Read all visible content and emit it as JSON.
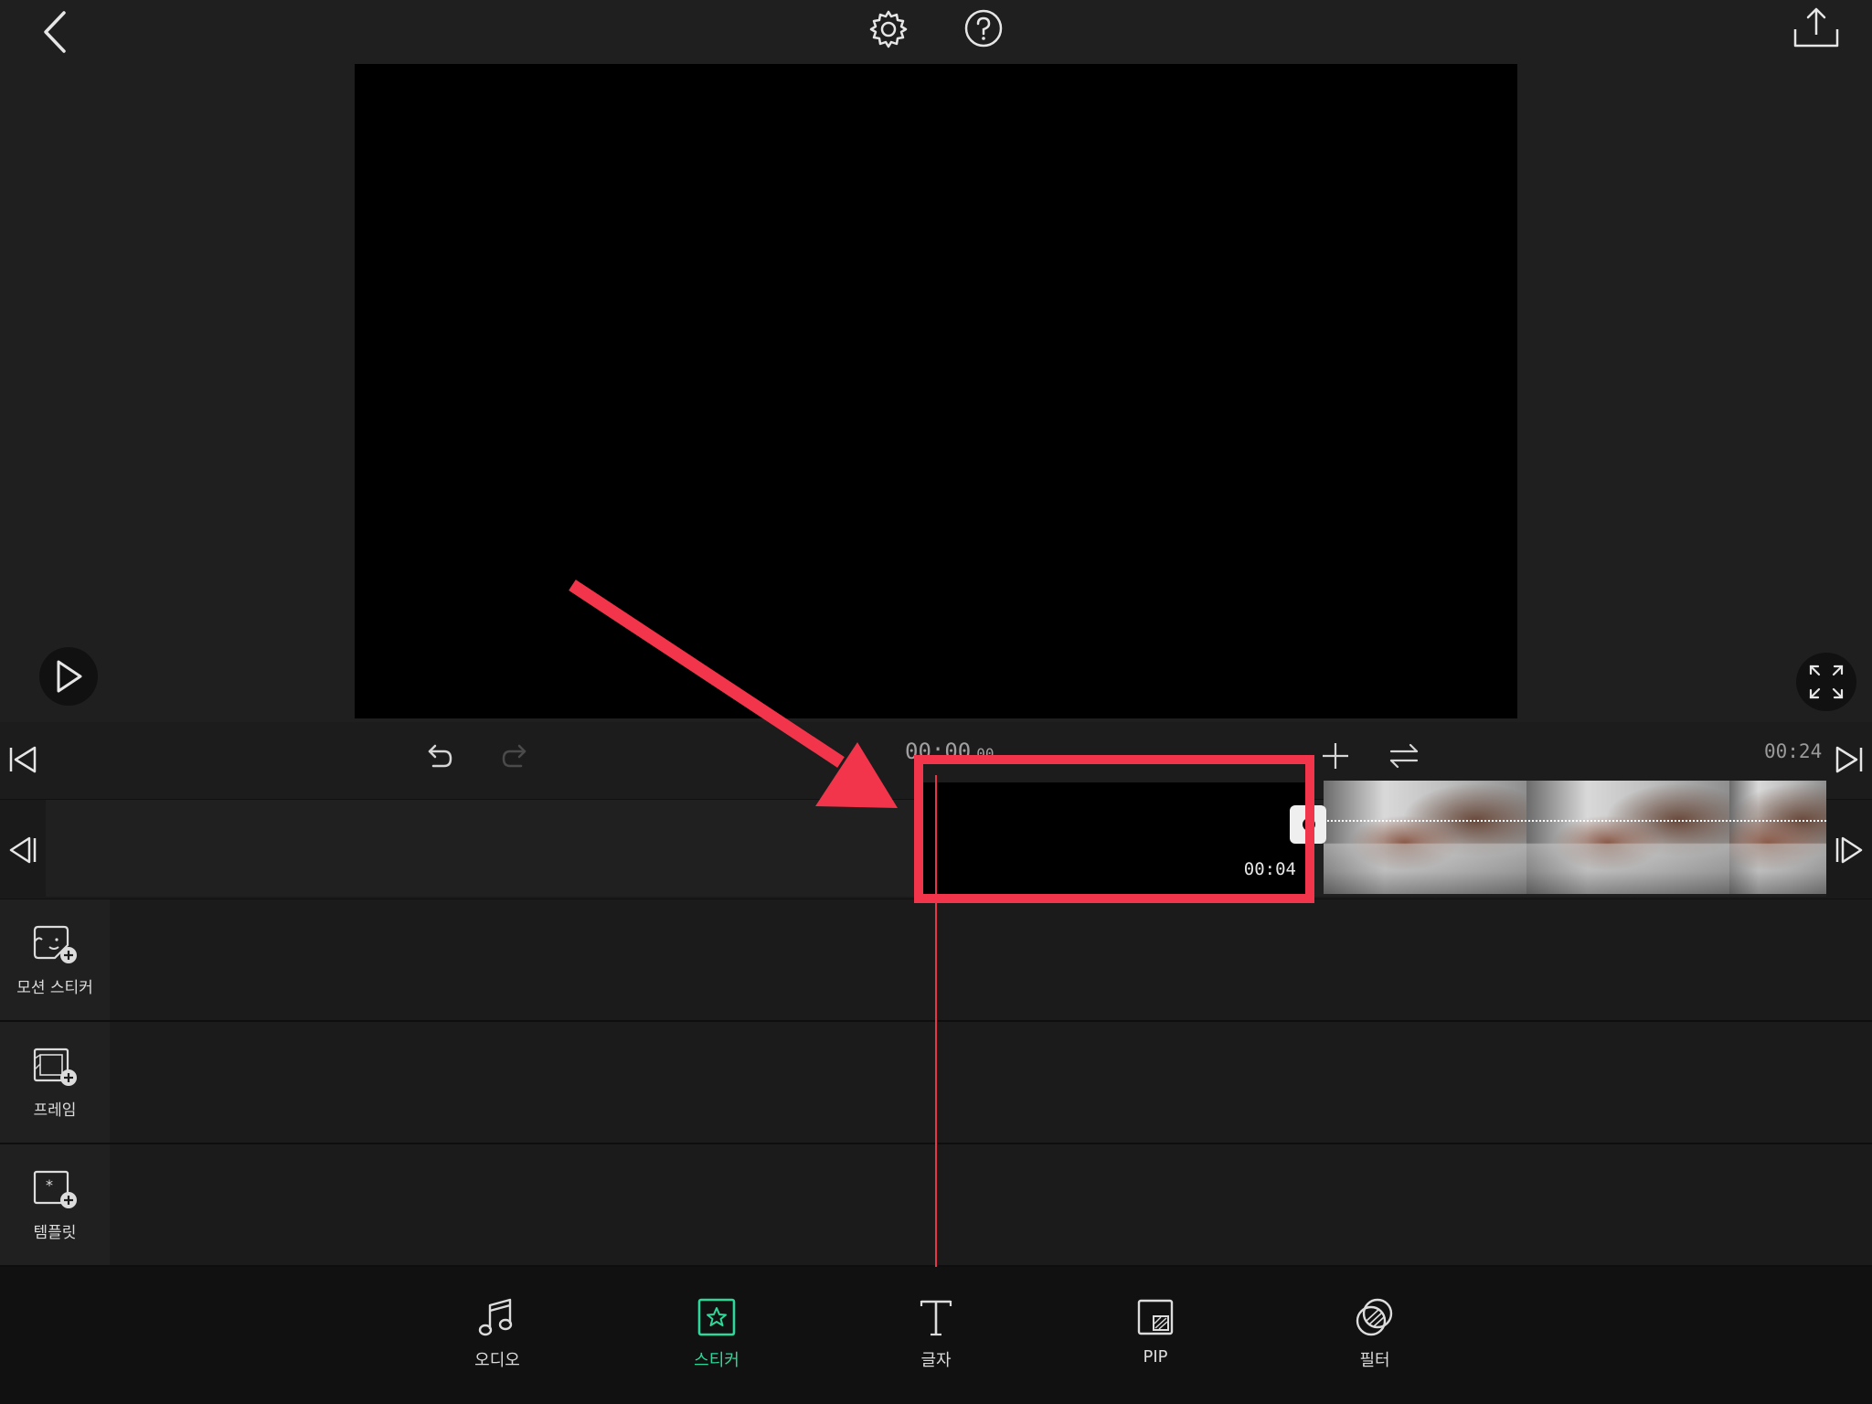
{
  "toolbar": {
    "back": "back",
    "settings": "settings",
    "help": "help",
    "export": "export"
  },
  "preview": {
    "play": "play",
    "fullscreen": "fullscreen"
  },
  "timeline": {
    "current_time": "00:00",
    "current_frame": "00",
    "total_time": "00:24",
    "clip_duration": "00:04"
  },
  "layers": [
    {
      "label": "모션 스티커",
      "icon": "motion-sticker-icon"
    },
    {
      "label": "프레임",
      "icon": "frame-icon"
    },
    {
      "label": "템플릿",
      "icon": "template-icon"
    }
  ],
  "bottom_nav": [
    {
      "label": "오디오",
      "icon": "music-note-icon",
      "active": false
    },
    {
      "label": "스티커",
      "icon": "sticker-star-icon",
      "active": true
    },
    {
      "label": "글자",
      "icon": "text-t-icon",
      "active": false
    },
    {
      "label": "PIP",
      "icon": "pip-icon",
      "active": false
    },
    {
      "label": "필터",
      "icon": "filter-icon",
      "active": false
    }
  ],
  "colors": {
    "accent": "#2ed89a",
    "annotation": "#f2354a",
    "background": "#1f1f1f"
  }
}
